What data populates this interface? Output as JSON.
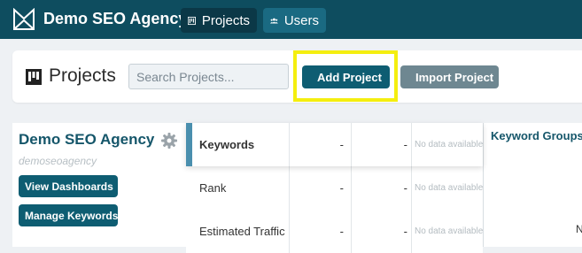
{
  "app": {
    "brand": "Demo SEO Agency",
    "nav": {
      "projects_label": "Projects",
      "users_label": "Users"
    }
  },
  "header": {
    "title": "Projects",
    "search_placeholder": "Search Projects...",
    "add_label": "Add Project",
    "import_label": "Import Project"
  },
  "project": {
    "name": "Demo SEO Agency",
    "slug": "demoseoagency",
    "view_dashboards_label": "View Dashboards",
    "manage_keywords_label": "Manage Keywords"
  },
  "metrics": {
    "rows": [
      {
        "label": "Keywords",
        "value1": "-",
        "value2": "-",
        "note": "No data available"
      },
      {
        "label": "Rank",
        "value1": "-",
        "value2": "-",
        "note": "No data available"
      },
      {
        "label": "Estimated Traffic",
        "value1": "-",
        "value2": "-",
        "note": "No data available"
      }
    ]
  },
  "keyword_groups": {
    "title": "Keyword Groups",
    "truncated_text": "N"
  },
  "colors": {
    "nav_bg": "#0e4d5f",
    "primary_button": "#0e5d72",
    "secondary_button": "#6e8791",
    "highlight": "#f4ee0f",
    "title_text": "#15566a"
  },
  "icons": [
    "logo-icon",
    "projects-icon",
    "users-icon",
    "plus-icon",
    "import-icon",
    "gear-icon"
  ]
}
